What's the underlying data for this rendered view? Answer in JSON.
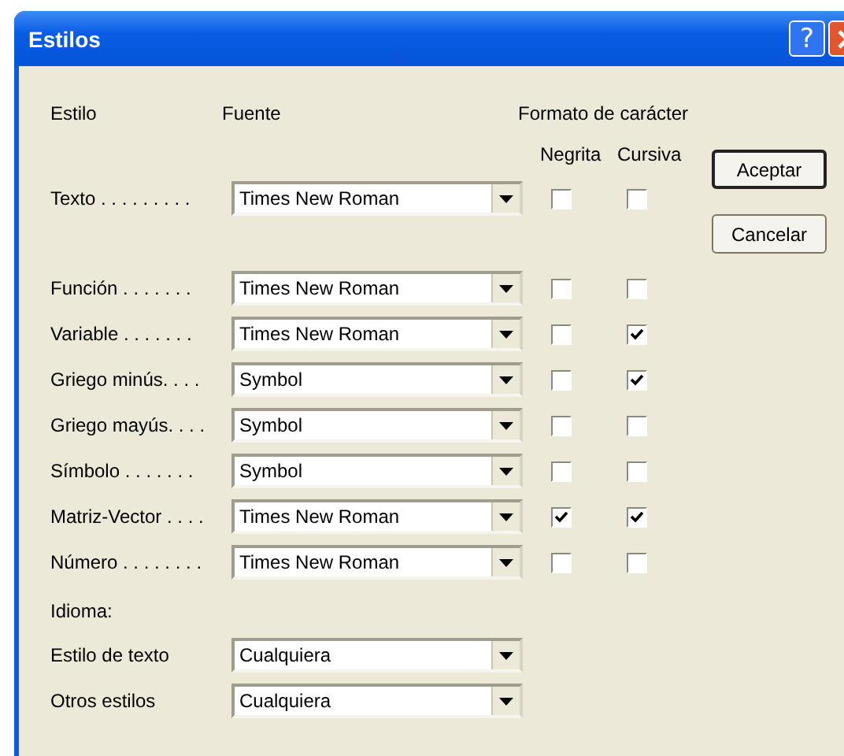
{
  "window": {
    "title": "Estilos",
    "help_button": "?"
  },
  "headers": {
    "style": "Estilo",
    "font": "Fuente",
    "format": "Formato de carácter",
    "bold": "Negrita",
    "italic": "Cursiva"
  },
  "text_style": {
    "label": "Texto . . . . . . . . .",
    "font": "Times New Roman",
    "bold": false,
    "italic": false
  },
  "styles": [
    {
      "label": "Función . . . . . . .",
      "font": "Times New Roman",
      "bold": false,
      "italic": false
    },
    {
      "label": "Variable . . . . . . .",
      "font": "Times New Roman",
      "bold": false,
      "italic": true
    },
    {
      "label": "Griego minús. . . .",
      "font": "Symbol",
      "bold": false,
      "italic": true
    },
    {
      "label": "Griego mayús. . . .",
      "font": "Symbol",
      "bold": false,
      "italic": false
    },
    {
      "label": "Símbolo . . . . . . .",
      "font": "Symbol",
      "bold": false,
      "italic": false
    },
    {
      "label": "Matriz-Vector . . . .",
      "font": "Times New Roman",
      "bold": true,
      "italic": true
    },
    {
      "label": "Número . . . . . . . .",
      "font": "Times New Roman",
      "bold": false,
      "italic": false
    }
  ],
  "language": {
    "heading": "Idioma:",
    "rows": [
      {
        "label": "Estilo de texto",
        "value": "Cualquiera"
      },
      {
        "label": "Otros estilos",
        "value": "Cualquiera"
      }
    ]
  },
  "buttons": [
    "Aceptar",
    "Cancelar"
  ]
}
